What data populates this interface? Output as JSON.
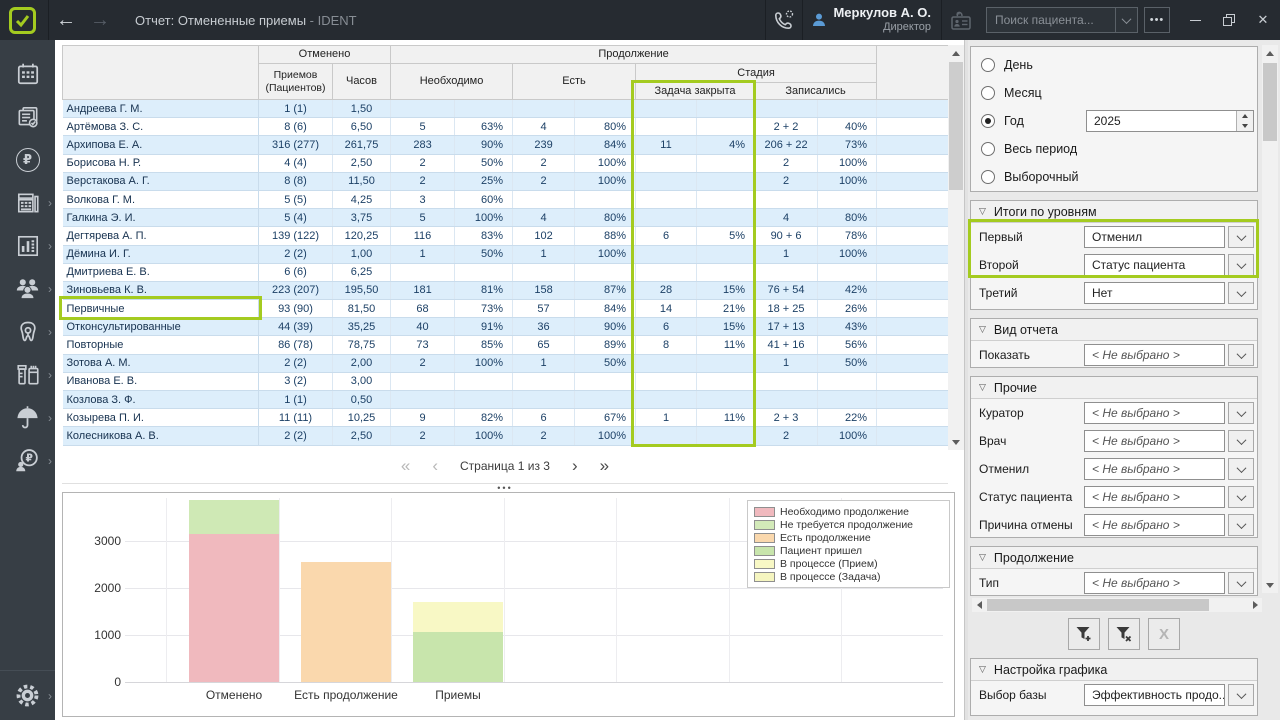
{
  "topbar": {
    "title": "Отчет: Отмененные приемы",
    "title_suffix": "- IDENT",
    "back_glyph": "←",
    "forward_glyph": "→",
    "user_name": "Меркулов А. О.",
    "user_role": "Директор",
    "search_placeholder": "Поиск пациента...",
    "more_label": "•••",
    "close_glyph": "✕"
  },
  "sidebar_items": [
    {
      "name": "schedule"
    },
    {
      "name": "tasks"
    },
    {
      "name": "payments"
    },
    {
      "name": "cashbox",
      "chevron": true
    },
    {
      "name": "reports",
      "chevron": true
    },
    {
      "name": "staff",
      "chevron": true
    },
    {
      "name": "treatment",
      "chevron": true
    },
    {
      "name": "warehouse",
      "chevron": true
    },
    {
      "name": "insurance",
      "chevron": true
    },
    {
      "name": "salary",
      "chevron": true
    },
    {
      "name": "settings",
      "chevron": true
    }
  ],
  "table": {
    "headers": {
      "cancelled": "Отменено",
      "continuation": "Продолжение",
      "appointments_patients": "Приемов (Пациентов)",
      "hours": "Часов",
      "need": "Необходимо",
      "have": "Есть",
      "stage": "Стадия",
      "task_closed": "Задача закрыта",
      "signed_up": "Записались"
    },
    "rows": [
      {
        "cells": [
          "Андреева Г. М.",
          "1 (1)",
          "1,50",
          "",
          "",
          "",
          "",
          "",
          "",
          "",
          ""
        ]
      },
      {
        "cells": [
          "Артёмова З. С.",
          "8 (6)",
          "6,50",
          "5",
          "63%",
          "4",
          "80%",
          "",
          "",
          "2 + 2",
          "40%"
        ]
      },
      {
        "cells": [
          "Архипова Е. А.",
          "316 (277)",
          "261,75",
          "283",
          "90%",
          "239",
          "84%",
          "11",
          "4%",
          "206 + 22",
          "73%"
        ]
      },
      {
        "cells": [
          "Борисова Н. Р.",
          "4 (4)",
          "2,50",
          "2",
          "50%",
          "2",
          "100%",
          "",
          "",
          "2",
          "100%"
        ]
      },
      {
        "cells": [
          "Верстакова А. Г.",
          "8 (8)",
          "11,50",
          "2",
          "25%",
          "2",
          "100%",
          "",
          "",
          "2",
          "100%"
        ]
      },
      {
        "cells": [
          "Волкова Г. М.",
          "5 (5)",
          "4,25",
          "3",
          "60%",
          "",
          "",
          "",
          "",
          "",
          ""
        ]
      },
      {
        "cells": [
          "Галкина Э. И.",
          "5 (4)",
          "3,75",
          "5",
          "100%",
          "4",
          "80%",
          "",
          "",
          "4",
          "80%"
        ]
      },
      {
        "cells": [
          "Дегтярева А. П.",
          "139 (122)",
          "120,25",
          "116",
          "83%",
          "102",
          "88%",
          "6",
          "5%",
          "90 + 6",
          "78%"
        ]
      },
      {
        "cells": [
          "Дёмина И. Г.",
          "2 (2)",
          "1,00",
          "1",
          "50%",
          "1",
          "100%",
          "",
          "",
          "1",
          "100%"
        ]
      },
      {
        "cells": [
          "Дмитриева Е. В.",
          "6 (6)",
          "6,25",
          "",
          "",
          "",
          "",
          "",
          "",
          "",
          ""
        ]
      },
      {
        "cells": [
          "Зиновьева К. В.",
          "223 (207)",
          "195,50",
          "181",
          "81%",
          "158",
          "87%",
          "28",
          "15%",
          "76 + 54",
          "42%"
        ]
      },
      {
        "cells": [
          "Первичные",
          "93 (90)",
          "81,50",
          "68",
          "73%",
          "57",
          "84%",
          "14",
          "21%",
          "18 + 25",
          "26%"
        ],
        "highlight": true
      },
      {
        "cells": [
          "Отконсультированные",
          "44 (39)",
          "35,25",
          "40",
          "91%",
          "36",
          "90%",
          "6",
          "15%",
          "17 + 13",
          "43%"
        ]
      },
      {
        "cells": [
          "Повторные",
          "86 (78)",
          "78,75",
          "73",
          "85%",
          "65",
          "89%",
          "8",
          "11%",
          "41 + 16",
          "56%"
        ]
      },
      {
        "cells": [
          "Зотова А. М.",
          "2 (2)",
          "2,00",
          "2",
          "100%",
          "1",
          "50%",
          "",
          "",
          "1",
          "50%"
        ]
      },
      {
        "cells": [
          "Иванова Е. В.",
          "3 (2)",
          "3,00",
          "",
          "",
          "",
          "",
          "",
          "",
          "",
          ""
        ]
      },
      {
        "cells": [
          "Козлова З. Ф.",
          "1 (1)",
          "0,50",
          "",
          "",
          "",
          "",
          "",
          "",
          "",
          ""
        ]
      },
      {
        "cells": [
          "Козырева П. И.",
          "11 (11)",
          "10,25",
          "9",
          "82%",
          "6",
          "67%",
          "1",
          "11%",
          "2 + 3",
          "22%"
        ]
      },
      {
        "cells": [
          "Колесникова А. В.",
          "2 (2)",
          "2,50",
          "2",
          "100%",
          "2",
          "100%",
          "",
          "",
          "2",
          "100%"
        ]
      }
    ]
  },
  "pagination": {
    "first": "«",
    "prev": "‹",
    "label": "Страница 1 из 3",
    "next": "›",
    "last": "»",
    "splitter_dots": "•••"
  },
  "chart_data": {
    "type": "bar",
    "stacked": true,
    "categories": [
      "Отменено",
      "Есть продолжение",
      "Приемы"
    ],
    "bars": [
      {
        "category": "Отменено",
        "segments": [
          {
            "name": "Необходимо продолжение",
            "value": 3150,
            "color": "#f0b9be"
          },
          {
            "name": "Не требуется продолжение",
            "value": 720,
            "color": "#cfe9b5"
          }
        ]
      },
      {
        "category": "Есть продолжение",
        "segments": [
          {
            "name": "Есть продолжение",
            "value": 2550,
            "color": "#fad8ad"
          }
        ]
      },
      {
        "category": "Приемы",
        "segments": [
          {
            "name": "Пациент пришел",
            "value": 1060,
            "color": "#c8e5ac"
          },
          {
            "name": "В процессе (Прием)",
            "value": 640,
            "color": "#f8f8c5"
          }
        ]
      }
    ],
    "yticks": [
      0,
      1000,
      2000,
      3000
    ],
    "ymax": 4000,
    "grid": true,
    "legend_position": "top-right",
    "legend": [
      {
        "label": "Необходимо продолжение",
        "color": "#f0b9be"
      },
      {
        "label": "Не требуется продолжение",
        "color": "#d3eab9"
      },
      {
        "label": "Есть продолжение",
        "color": "#fad8ad"
      },
      {
        "label": "Пациент пришел",
        "color": "#c8e5ac"
      },
      {
        "label": "В процессе (Прием)",
        "color": "#f8f8c5"
      },
      {
        "label": "В процессе (Задача)",
        "color": "#f5f5c0"
      }
    ]
  },
  "right_panel": {
    "period": [
      {
        "label": "День",
        "selected": false
      },
      {
        "label": "Месяц",
        "selected": false
      },
      {
        "label": "Год",
        "selected": true,
        "value": "2025"
      },
      {
        "label": "Весь период",
        "selected": false
      },
      {
        "label": "Выборочный",
        "selected": false
      }
    ],
    "sections": [
      {
        "title": "Итоги по уровням",
        "rows": [
          {
            "label": "Первый",
            "value": "Отменил"
          },
          {
            "label": "Второй",
            "value": "Статус пациента"
          },
          {
            "label": "Третий",
            "value": "Нет"
          }
        ]
      },
      {
        "title": "Вид отчета",
        "rows": [
          {
            "label": "Показать",
            "value": "< Не выбрано >",
            "muted": true
          }
        ]
      },
      {
        "title": "Прочие",
        "rows": [
          {
            "label": "Куратор",
            "value": "< Не выбрано >",
            "muted": true
          },
          {
            "label": "Врач",
            "value": "< Не выбрано >",
            "muted": true
          },
          {
            "label": "Отменил",
            "value": "< Не выбрано >",
            "muted": true
          },
          {
            "label": "Статус пациента",
            "value": "< Не выбрано >",
            "muted": true
          },
          {
            "label": "Причина отмены",
            "value": "< Не выбрано >",
            "muted": true
          }
        ]
      },
      {
        "title": "Продолжение",
        "rows": [
          {
            "label": "Тип",
            "value": "< Не выбрано >",
            "muted": true
          }
        ]
      }
    ],
    "chart_settings": {
      "title": "Настройка графика",
      "rows": [
        {
          "label": "Выбор базы",
          "value": "Эффективность продо..."
        }
      ]
    },
    "x_button_label": "X"
  },
  "accent_color": "#a4cb20"
}
